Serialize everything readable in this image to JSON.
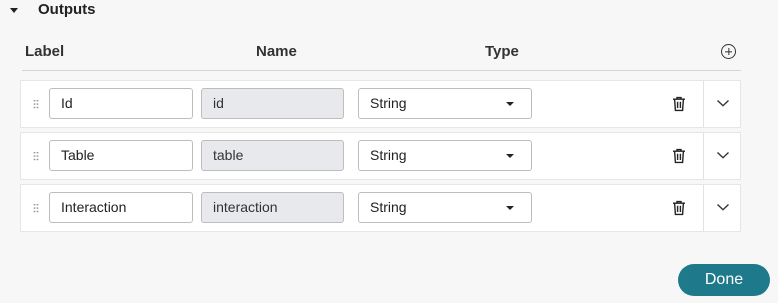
{
  "section": {
    "title": "Outputs",
    "expanded": true
  },
  "columns": {
    "label": "Label",
    "name": "Name",
    "type": "Type"
  },
  "add_icon": "add-circle-icon",
  "rows": [
    {
      "label": "Id",
      "name": "id",
      "type": "String"
    },
    {
      "label": "Table",
      "name": "table",
      "type": "String"
    },
    {
      "label": "Interaction",
      "name": "interaction",
      "type": "String"
    }
  ],
  "row_icons": {
    "grip": "drag-handle-icon",
    "delete": "trash-icon",
    "expand": "chevron-down-icon"
  },
  "done_label": "Done",
  "colors": {
    "done_button": "#1e7a8a",
    "readonly_field": "#e7e9ec",
    "background": "#f7f7f7"
  }
}
